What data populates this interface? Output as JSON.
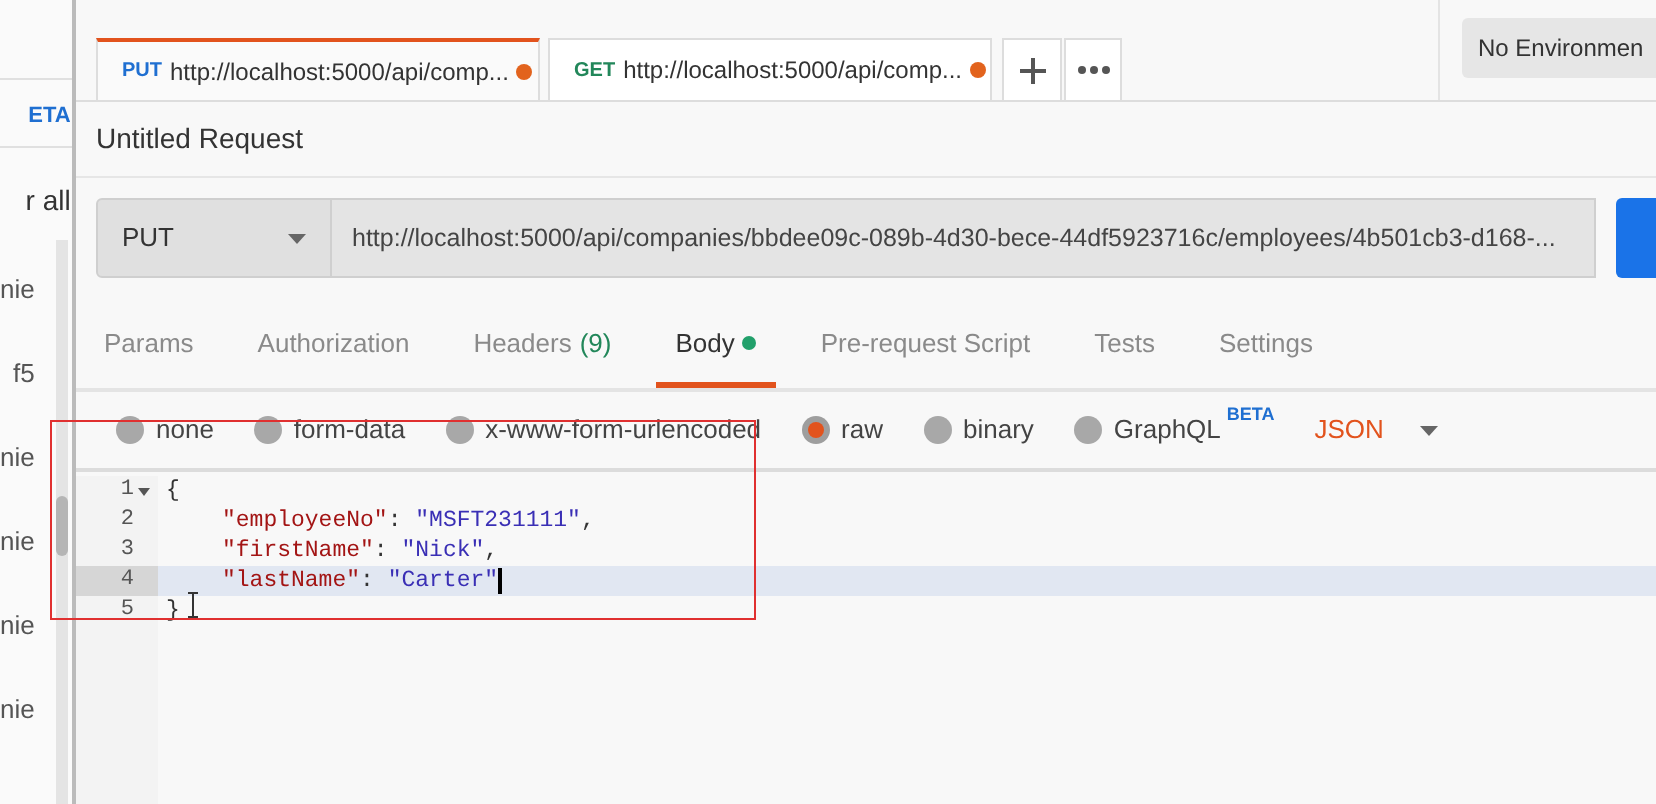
{
  "sidebar": {
    "items": [
      {
        "kind": "badge",
        "text": "ETA"
      },
      {
        "kind": "link",
        "text": "r all"
      },
      {
        "kind": "item",
        "text": "nie"
      },
      {
        "kind": "item",
        "text": "f5"
      },
      {
        "kind": "item",
        "text": "nie"
      },
      {
        "kind": "item",
        "text": "nie"
      },
      {
        "kind": "item",
        "text": "nie"
      },
      {
        "kind": "item",
        "text": "nie"
      }
    ]
  },
  "tabs": [
    {
      "method": "PUT",
      "url": "http://localhost:5000/api/comp...",
      "selected": true,
      "unsaved": true
    },
    {
      "method": "GET",
      "url": "http://localhost:5000/api/comp...",
      "selected": false,
      "unsaved": true
    }
  ],
  "environment": "No Environmen",
  "request": {
    "title": "Untitled Request",
    "method": "PUT",
    "url": "http://localhost:5000/api/companies/bbdee09c-089b-4d30-bece-44df5923716c/employees/4b501cb3-d168-..."
  },
  "request_tabs": [
    {
      "label": "Params",
      "selected": false
    },
    {
      "label": "Authorization",
      "selected": false
    },
    {
      "label": "Headers",
      "count": "(9)",
      "selected": false
    },
    {
      "label": "Body",
      "selected": true,
      "dot": true
    },
    {
      "label": "Pre-request Script",
      "selected": false
    },
    {
      "label": "Tests",
      "selected": false
    },
    {
      "label": "Settings",
      "selected": false
    }
  ],
  "body_types": [
    {
      "label": "none",
      "selected": false
    },
    {
      "label": "form-data",
      "selected": false
    },
    {
      "label": "x-www-form-urlencoded",
      "selected": false
    },
    {
      "label": "raw",
      "selected": true
    },
    {
      "label": "binary",
      "selected": false
    },
    {
      "label": "GraphQL",
      "badge": "BETA",
      "selected": false
    }
  ],
  "format": "JSON",
  "editor": {
    "lines": [
      {
        "number": "1",
        "fold": true,
        "current": false,
        "indent": false,
        "tokens": [
          {
            "kind": "punct",
            "text": "{"
          }
        ]
      },
      {
        "number": "2",
        "fold": false,
        "current": false,
        "indent": true,
        "tokens": [
          {
            "kind": "key",
            "text": "\"employeeNo\""
          },
          {
            "kind": "punct",
            "text": ": "
          },
          {
            "kind": "string",
            "text": "\"MSFT231111\""
          },
          {
            "kind": "punct",
            "text": ","
          }
        ]
      },
      {
        "number": "3",
        "fold": false,
        "current": false,
        "indent": true,
        "tokens": [
          {
            "kind": "key",
            "text": "\"firstName\""
          },
          {
            "kind": "punct",
            "text": ": "
          },
          {
            "kind": "string",
            "text": "\"Nick\""
          },
          {
            "kind": "punct",
            "text": ","
          }
        ]
      },
      {
        "number": "4",
        "fold": false,
        "current": true,
        "indent": true,
        "tokens": [
          {
            "kind": "key",
            "text": "\"lastName\""
          },
          {
            "kind": "punct",
            "text": ": "
          },
          {
            "kind": "string",
            "text": "\"Carter\""
          }
        ]
      },
      {
        "number": "5",
        "fold": false,
        "current": false,
        "indent": false,
        "tokens": [
          {
            "kind": "punct",
            "text": "}"
          }
        ]
      }
    ]
  }
}
